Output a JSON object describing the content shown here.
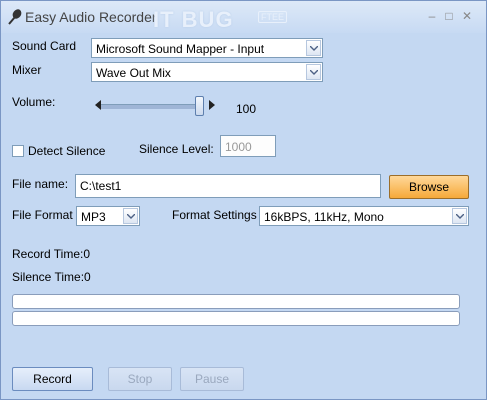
{
  "window": {
    "title": "Easy Audio Recorder",
    "watermark": "IT BUG",
    "watermark_badge": "FTEE"
  },
  "sound_card": {
    "label": "Sound Card",
    "value": "Microsoft Sound Mapper - Input"
  },
  "mixer": {
    "label": "Mixer",
    "value": "Wave Out Mix"
  },
  "volume": {
    "label": "Volume:",
    "value": "100",
    "level": 1.0
  },
  "detect_silence": {
    "label": "Detect Silence",
    "checked": false
  },
  "silence_level": {
    "label": "Silence Level:",
    "value": "1000"
  },
  "file_name": {
    "label": "File name:",
    "value": "C:\\test1",
    "browse_label": "Browse"
  },
  "file_format": {
    "label": "File Format",
    "value": "MP3"
  },
  "format_settings": {
    "label": "Format Settings",
    "value": "16kBPS, 11kHz, Mono"
  },
  "status": {
    "record_time": "Record Time:0",
    "silence_time": "Silence Time:0"
  },
  "progress": {
    "bar1": 0,
    "bar2": 0
  },
  "buttons": {
    "record": "Record",
    "stop": "Stop",
    "pause": "Pause"
  },
  "colors": {
    "accent": "#f6a93a",
    "background": "#c4d8f2"
  }
}
